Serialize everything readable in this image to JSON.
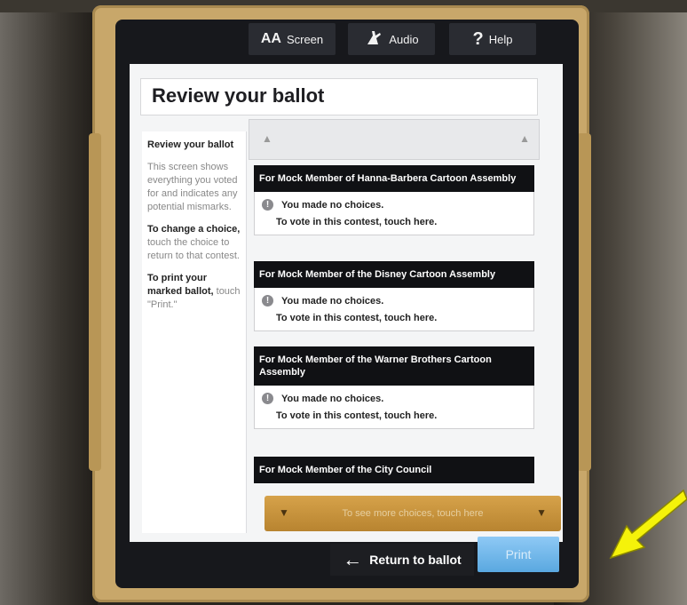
{
  "toolbar": {
    "screen_label": "Screen",
    "screen_icon": "AA",
    "audio_label": "Audio",
    "help_label": "Help",
    "help_icon": "?"
  },
  "page": {
    "title": "Review your ballot"
  },
  "sidebar": {
    "heading": "Review your ballot",
    "para1": "This screen shows everything you voted for and indicates any potential mismarks.",
    "para2_strong": "To change a choice,",
    "para2_rest": " touch the choice to return to that contest.",
    "para3_strong": "To print your marked ballot,",
    "para3_rest": " touch \"Print.\""
  },
  "contests": [
    {
      "title": "For Mock Member of Hanna-Barbera Cartoon Assembly",
      "status": "You made no choices.",
      "action": "To vote in this contest, touch here."
    },
    {
      "title": "For Mock Member of the Disney Cartoon Assembly",
      "status": "You made no choices.",
      "action": "To vote in this contest, touch here."
    },
    {
      "title": "For Mock Member of the Warner Brothers Cartoon Assembly",
      "status": "You made no choices.",
      "action": "To vote in this contest, touch here."
    },
    {
      "title": "For Mock Member of the City Council"
    }
  ],
  "more_choices_label": "To see more choices, touch here",
  "return_label": "Return to ballot",
  "print_label": "Print",
  "colors": {
    "frame": "#c8a76a",
    "more_bar": "#d6a24a",
    "print_button": "#5aa8e0",
    "annotation_arrow": "#f5f20a"
  }
}
